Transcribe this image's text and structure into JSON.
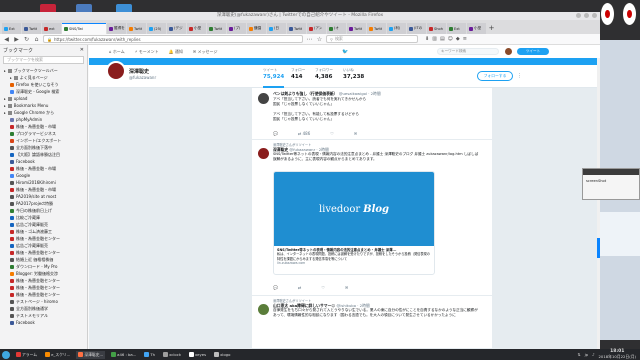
{
  "window": {
    "title": "深澤聡史(@fukazawanr)さん | Twitterでの自己紹介やツイート - Mozilla Firefox"
  },
  "tabs": [
    "Ext",
    "Twitt",
    "ext",
    "SNS/Twi",
    "獲得を",
    "Twitt",
    "(25)",
    "(デジ",
    "小型",
    "Twitt",
    "(プ(",
    "鎌園",
    "(日",
    "Twitt",
    "(アン",
    "(オ",
    "Twitt",
    "Twitt",
    "(利(",
    "(ITの",
    "Shoh",
    "Ext",
    "小型"
  ],
  "active_tab": "SNS/Twi",
  "url": "https://twitter.com/fukazawanr/with_replies",
  "search_placeholder": "検索",
  "sidebar": {
    "title": "ブックマーク",
    "search_placeholder": "ブックマークを検索",
    "items": [
      {
        "label": "ブックマークツールバー",
        "level": 0,
        "folder": true,
        "color": "#888888"
      },
      {
        "label": "よく見るページ",
        "level": 1,
        "folder": true,
        "color": "#888888"
      },
      {
        "label": "Firefox を使いこなそう",
        "level": 1,
        "folder": false,
        "color": "#e66000"
      },
      {
        "label": "深澤聡史 - Google 検索",
        "level": 1,
        "folder": false,
        "color": "#4285f4"
      },
      {
        "label": "upload",
        "level": 0,
        "folder": true,
        "color": "#888888"
      },
      {
        "label": "Bookmarks Menu",
        "level": 0,
        "folder": true,
        "color": "#888888"
      },
      {
        "label": "Google Chrome から",
        "level": 0,
        "folder": true,
        "color": "#888888"
      },
      {
        "label": "phpMyAdmin",
        "level": 1,
        "folder": false,
        "color": "#6c78af"
      },
      {
        "label": "株価・為替金融・市場",
        "level": 1,
        "folder": false,
        "color": "#c62828"
      },
      {
        "label": "プログラマービジネス",
        "level": 1,
        "folder": false,
        "color": "#2e7d32"
      },
      {
        "label": "インポート/エクスポート",
        "level": 1,
        "folder": false,
        "color": "#d84315"
      },
      {
        "label": "全方面別株価下落中",
        "level": 1,
        "folder": false,
        "color": "#555555"
      },
      {
        "label": "【大阪】論語林勝店注目",
        "level": 1,
        "folder": false,
        "color": "#1565c0"
      },
      {
        "label": "Facebook",
        "level": 1,
        "folder": false,
        "color": "#3b5998"
      },
      {
        "label": "株価・為替金融・市場",
        "level": 1,
        "folder": false,
        "color": "#c62828"
      },
      {
        "label": "Google",
        "level": 1,
        "folder": false,
        "color": "#4285f4"
      },
      {
        "label": "Hiromi2016Kihiromi",
        "level": 1,
        "folder": false,
        "color": "#555555"
      },
      {
        "label": "株価・為替金融・市場",
        "level": 1,
        "folder": false,
        "color": "#c62828"
      },
      {
        "label": "PA2019/site at most",
        "level": 1,
        "folder": false,
        "color": "#555555"
      },
      {
        "label": "PA2017project特勝",
        "level": 1,
        "folder": false,
        "color": "#555555"
      },
      {
        "label": "今日の株価前日上げ",
        "level": 1,
        "folder": false,
        "color": "#2e7d32"
      },
      {
        "label": "比較ご冷蔵庫",
        "level": 1,
        "folder": false,
        "color": "#1565c0"
      },
      {
        "label": "広告ご冷蔵庫販売",
        "level": 1,
        "folder": false,
        "color": "#1565c0"
      },
      {
        "label": "株価・ゴム済液藤工",
        "level": 1,
        "folder": false,
        "color": "#c62828"
      },
      {
        "label": "株価・為替金融センター",
        "level": 1,
        "folder": false,
        "color": "#c62828"
      },
      {
        "label": "広告ご冷蔵庫販売",
        "level": 1,
        "folder": false,
        "color": "#1565c0"
      },
      {
        "label": "株価・為替金融センター",
        "level": 1,
        "folder": false,
        "color": "#c62828"
      },
      {
        "label": "結婚上近 価格相株価",
        "level": 1,
        "folder": false,
        "color": "#555555"
      },
      {
        "label": "ダウンロード - My Pro",
        "level": 1,
        "folder": false,
        "color": "#2e7d32"
      },
      {
        "label": "Blogger: 労働価格交渉",
        "level": 1,
        "folder": false,
        "color": "#f57c00"
      },
      {
        "label": "株価・為替金融センター",
        "level": 1,
        "folder": false,
        "color": "#c62828"
      },
      {
        "label": "株価・為替金融センター",
        "level": 1,
        "folder": false,
        "color": "#c62828"
      },
      {
        "label": "株価・為替金融センター",
        "level": 1,
        "folder": false,
        "color": "#c62828"
      },
      {
        "label": "テストページ - hiromo",
        "level": 1,
        "folder": false,
        "color": "#555555"
      },
      {
        "label": "全方面別株価通学",
        "level": 1,
        "folder": false,
        "color": "#555555"
      },
      {
        "label": "テストメモリアル",
        "level": 1,
        "folder": false,
        "color": "#555555"
      },
      {
        "label": "Facebook",
        "level": 1,
        "folder": false,
        "color": "#3b5998"
      }
    ]
  },
  "twitter": {
    "nav": [
      "ホーム",
      "モーメント",
      "通知",
      "メッセージ"
    ],
    "search_placeholder": "キーワード検索",
    "tweet_button": "ツイート",
    "profile": {
      "name": "深澤聡史",
      "handle": "@fukazawanr"
    },
    "stats": [
      {
        "label": "ツイート",
        "value": "75,924"
      },
      {
        "label": "フォロー",
        "value": "414"
      },
      {
        "label": "フォロワー",
        "value": "4,386"
      },
      {
        "label": "いいね",
        "value": "37,238"
      }
    ],
    "follow_button": "フォローする",
    "tweets": [
      {
        "context": "",
        "name": "ペンは剣よりも強し（行使保価表紙）",
        "handle": "@uesaikawigol · 2時間",
        "body": "アベ「担当して下さい。読者でも何を実れてきかせんから\n国民「じゃ投票しなくていいじゃん」\n\nアベ「担当して下さい。有能して私投票するけどから\n国民「じゃ投票しなくていいじゃん」",
        "replies": "",
        "retweets": "486",
        "likes": "",
        "color": "#444444"
      },
      {
        "context": "深澤聡史さんがリツイート",
        "name": "深澤聡史",
        "handle": "@fukazawanr · 2時間",
        "body": "SNS/Twitter等ネットの表現・情報内容の法的注意点まとめ - 弁護士 深澤聡史のブログ 弁護士 zukazawanr/log.htm\nしばしば誤解があるように、主に表現内容の観点からまとめてあります。",
        "card_title": "SNS/Twitter等ネットの表現・情報内容の法的注意点まとめ - 弁護士 深澤...",
        "card_body": "私は、インターネットの表現問題、投稿には誤解を受けたりですが、投稿をしたそうから投稿（発信表現の特性を課題にからみまする発信事項を等について",
        "card_url": "lin.zukazawa.com",
        "card_logo": "livedoor",
        "card_logo2": "Blog",
        "replies": "",
        "retweets": "",
        "likes": "",
        "color": "#8a1d1d"
      },
      {
        "context": "深澤聡史さんがリツイート",
        "name": "山口恵太 aka障碍に詳しいサマー☺",
        "handle": "@ishikubo · 2時間",
        "body": "自律発生をもち口々から発されて入とうやりない生でいる。業人の東に自分の性がにことを自責するなかのような正当に観察があって、環境情報性的な相談になります（国わる言語でも。を大人の領目について発生させているかかったように",
        "replies": "",
        "retweets": "",
        "likes": "",
        "color": "#5a7d3a"
      }
    ]
  },
  "screenshot_window": {
    "title": "",
    "label": "screenShot"
  },
  "taskbar": {
    "items": [
      {
        "label": "アラーム",
        "color": "#e53935"
      },
      {
        "label": "e_スクリ...",
        "color": "#fb8c00"
      },
      {
        "label": "深澤聡史...",
        "color": "#ff7043"
      },
      {
        "label": "a46 : ba...",
        "color": "#43a047"
      },
      {
        "label": "Th",
        "color": "#42a5f5"
      },
      {
        "label": "xclock",
        "color": "#9e9e9e"
      },
      {
        "label": "xeyes",
        "color": "#ffffff"
      },
      {
        "label": "xlogo",
        "color": "#bdbdbd"
      }
    ],
    "ime": "jp",
    "time": "18:01",
    "date": "2018年10月22日(月)"
  }
}
